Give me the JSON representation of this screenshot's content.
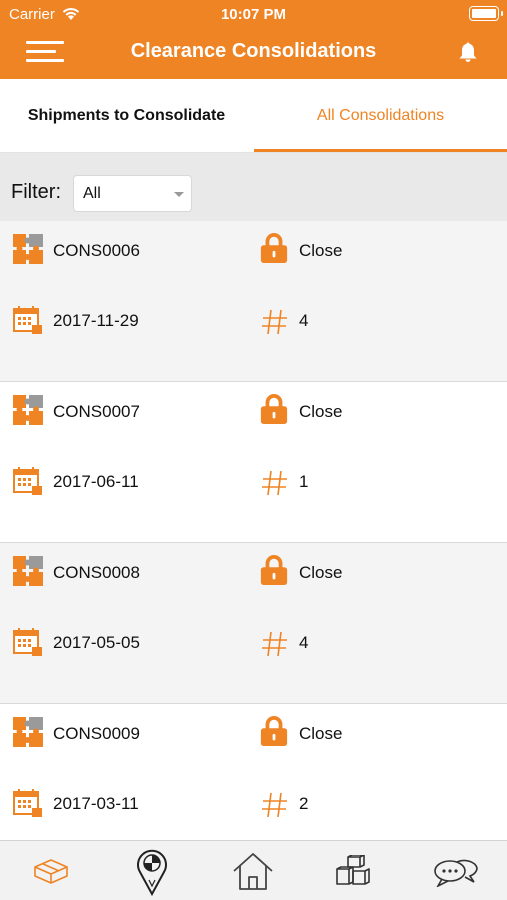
{
  "status_bar": {
    "carrier": "Carrier",
    "time": "10:07 PM"
  },
  "header": {
    "title": "Clearance Consolidations"
  },
  "tabs": [
    {
      "label": "Shipments to Consolidate",
      "active": false
    },
    {
      "label": "All Consolidations",
      "active": true
    }
  ],
  "filter": {
    "label": "Filter:",
    "value": "All"
  },
  "consolidations": [
    {
      "id": "CONS0006",
      "status": "Close",
      "date": "2017-11-29",
      "count": "4"
    },
    {
      "id": "CONS0007",
      "status": "Close",
      "date": "2017-06-11",
      "count": "1"
    },
    {
      "id": "CONS0008",
      "status": "Close",
      "date": "2017-05-05",
      "count": "4"
    },
    {
      "id": "CONS0009",
      "status": "Close",
      "date": "2017-03-11",
      "count": "2"
    }
  ],
  "icons": {
    "consolidation": "puzzle-icon",
    "status": "lock-icon",
    "date": "calendar-icon",
    "count": "hash-icon"
  },
  "bottom_nav": [
    {
      "icon": "consolidate-box-icon",
      "active": true
    },
    {
      "icon": "location-pin-icon",
      "active": false
    },
    {
      "icon": "home-icon",
      "active": false
    },
    {
      "icon": "boxes-icon",
      "active": false
    },
    {
      "icon": "chat-icon",
      "active": false
    }
  ],
  "colors": {
    "accent": "#ee8424",
    "row_alt": "#f4f4f4",
    "filter_bg": "#e9e9e9"
  }
}
